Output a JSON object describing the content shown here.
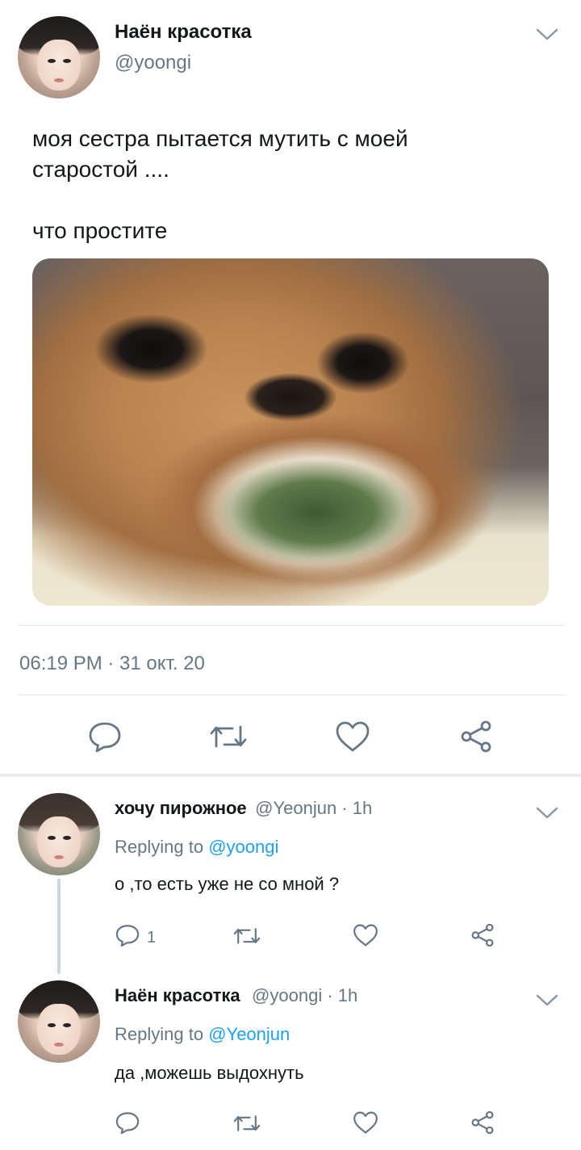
{
  "tweet": {
    "author_name": "Наён красотка",
    "author_handle": "@yoongi",
    "text_line1": "моя сестра пытается мутить с моей",
    "text_line2": "старостой  ....",
    "text_line3": "что простите",
    "timestamp": "06:19 PM · 31 окт. 20",
    "menu_icon": "chevron-down-icon",
    "actions": [
      "reply-icon",
      "retweet-icon",
      "like-icon",
      "share-icon"
    ]
  },
  "replies": [
    {
      "author_name": "хочу пирожное",
      "author_handle": "@Yeonjun · 1h",
      "replying_prefix": "Replying to",
      "replying_to": "@yoongi",
      "text": "о ,то есть уже не со мной ?",
      "reply_count": "1"
    },
    {
      "author_name": "Наён красотка",
      "author_handle": "@yoongi · 1h",
      "replying_prefix": "Replying to",
      "replying_to": "@Yeonjun",
      "text": "да ,можешь выдохнуть",
      "reply_count": ""
    }
  ],
  "colors": {
    "text": "#14171a",
    "secondary": "#657786",
    "link": "#1da1f2",
    "divider": "#e1e8ed"
  }
}
